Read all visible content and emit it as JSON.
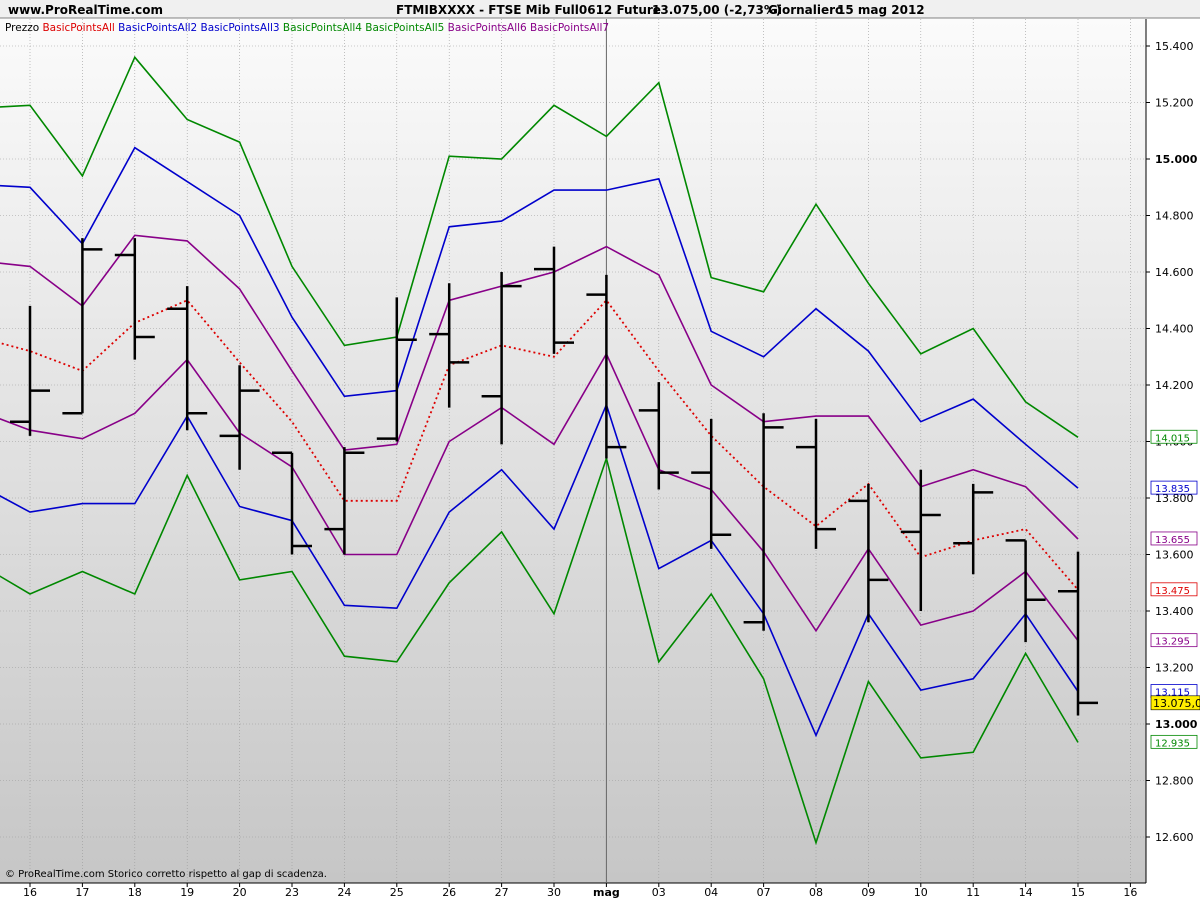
{
  "header": {
    "site": "www.ProRealTime.com",
    "instrument": "FTMIBXXXX - FTSE Mib Full0612 Future",
    "price_change": "13.075,00 (-2,73%)",
    "period": "Giornaliero",
    "date": "15 mag 2012",
    "bg_color": "#f0f0f0",
    "text_color": "#000000"
  },
  "footer_note": "© ProRealTime.com  Storico corretto rispetto al gap di scadenza.",
  "legend": [
    {
      "label": "Prezzo",
      "color": "#000000"
    },
    {
      "label": "BasicPointsAll",
      "color": "#dd0000"
    },
    {
      "label": "BasicPointsAll2",
      "color": "#0000cc"
    },
    {
      "label": "BasicPointsAll3",
      "color": "#0000cc"
    },
    {
      "label": "BasicPointsAll4",
      "color": "#008800"
    },
    {
      "label": "BasicPointsAll5",
      "color": "#008800"
    },
    {
      "label": "BasicPointsAll6",
      "color": "#880088"
    },
    {
      "label": "BasicPointsAll7",
      "color": "#880088"
    }
  ],
  "chart_data": {
    "type": "line",
    "ylim": [
      12480,
      15520
    ],
    "y_ticks": [
      "12.600",
      "12.800",
      "13.000",
      "13.200",
      "13.400",
      "13.600",
      "13.800",
      "14.000",
      "14.200",
      "14.400",
      "14.600",
      "14.800",
      "15.000",
      "15.200",
      "15.400"
    ],
    "y_tick_values": [
      12600,
      12800,
      13000,
      13200,
      13400,
      13600,
      13800,
      14000,
      14200,
      14400,
      14600,
      14800,
      15000,
      15200,
      15400
    ],
    "y_tick_bold": [
      "13.000",
      "15.000"
    ],
    "categories": [
      "16",
      "17",
      "18",
      "19",
      "20",
      "23",
      "24",
      "25",
      "26",
      "27",
      "30",
      "mag",
      "03",
      "04",
      "07",
      "08",
      "09",
      "10",
      "11",
      "14",
      "15",
      "16"
    ],
    "category_bold": [
      "mag"
    ],
    "category_separator": "mag",
    "ohlc": [
      {
        "o": 14070,
        "h": 14480,
        "l": 14020,
        "c": 14180
      },
      {
        "o": 14100,
        "h": 14720,
        "l": 14100,
        "c": 14680
      },
      {
        "o": 14660,
        "h": 14720,
        "l": 14290,
        "c": 14370
      },
      {
        "o": 14470,
        "h": 14550,
        "l": 14040,
        "c": 14100
      },
      {
        "o": 14020,
        "h": 14270,
        "l": 13900,
        "c": 14180
      },
      {
        "o": 13960,
        "h": 13960,
        "l": 13600,
        "c": 13630
      },
      {
        "o": 13690,
        "h": 13980,
        "l": 13600,
        "c": 13960
      },
      {
        "o": 14010,
        "h": 14510,
        "l": 14000,
        "c": 14360
      },
      {
        "o": 14380,
        "h": 14560,
        "l": 14120,
        "c": 14280
      },
      {
        "o": 14160,
        "h": 14600,
        "l": 13990,
        "c": 14550
      },
      {
        "o": 14610,
        "h": 14690,
        "l": 14310,
        "c": 14350
      },
      {
        "o": 14520,
        "h": 14590,
        "l": 13940,
        "c": 13980
      },
      {
        "o": 14110,
        "h": 14210,
        "l": 13830,
        "c": 13890
      },
      {
        "o": 13890,
        "h": 14080,
        "l": 13620,
        "c": 13670
      },
      {
        "o": 13360,
        "h": 14100,
        "l": 13330,
        "c": 14050
      },
      {
        "o": 13980,
        "h": 14080,
        "l": 13620,
        "c": 13690
      },
      {
        "o": 13790,
        "h": 13850,
        "l": 13360,
        "c": 13510
      },
      {
        "o": 13680,
        "h": 13900,
        "l": 13400,
        "c": 13740
      },
      {
        "o": 13640,
        "h": 13850,
        "l": 13530,
        "c": 13820
      },
      {
        "o": 13650,
        "h": 13650,
        "l": 13290,
        "c": 13440
      },
      {
        "o": 13470,
        "h": 13610,
        "l": 13030,
        "c": 13075
      }
    ],
    "series": [
      {
        "name": "BasicPointsAll",
        "color": "#dd0000",
        "dashed": true,
        "label": "13.475",
        "label_bg": "#ffffff",
        "values": [
          14370,
          14320,
          14250,
          14420,
          14500,
          14280,
          14070,
          13790,
          13790,
          14270,
          14340,
          14300,
          14500,
          14250,
          14020,
          13840,
          13700,
          13850,
          13590,
          13650,
          13690,
          13475
        ]
      },
      {
        "name": "BasicPointsAll2",
        "color": "#0000cc",
        "dashed": false,
        "label": "13.835",
        "label_bg": "#ffffff",
        "values": [
          14910,
          14900,
          14700,
          15040,
          14920,
          14800,
          14440,
          14160,
          14180,
          14760,
          14780,
          14890,
          14890,
          14930,
          14390,
          14300,
          14470,
          14320,
          14070,
          14150,
          13990,
          13835
        ]
      },
      {
        "name": "BasicPointsAll3",
        "color": "#0000cc",
        "dashed": false,
        "label": "13.115",
        "label_bg": "#ffffff",
        "values": [
          13850,
          13750,
          13780,
          13780,
          14090,
          13770,
          13720,
          13420,
          13410,
          13750,
          13900,
          13690,
          14130,
          13550,
          13650,
          13390,
          12960,
          13390,
          13120,
          13160,
          13390,
          13115
        ]
      },
      {
        "name": "BasicPointsAll4",
        "color": "#008800",
        "dashed": false,
        "label": "14.015",
        "label_bg": "#ffffff",
        "values": [
          15180,
          15190,
          14940,
          15360,
          15140,
          15060,
          14620,
          14340,
          14370,
          15010,
          15000,
          15190,
          15080,
          15270,
          14580,
          14530,
          14840,
          14560,
          14310,
          14400,
          14140,
          14015
        ]
      },
      {
        "name": "BasicPointsAll5",
        "color": "#008800",
        "dashed": false,
        "label": "12.935",
        "label_bg": "#ffffff",
        "values": [
          13570,
          13460,
          13540,
          13460,
          13880,
          13510,
          13540,
          13240,
          13220,
          13500,
          13680,
          13390,
          13940,
          13220,
          13460,
          13160,
          12580,
          13150,
          12880,
          12900,
          13250,
          12935
        ]
      },
      {
        "name": "BasicPointsAll6",
        "color": "#880088",
        "dashed": false,
        "label": "13.655",
        "label_bg": "#ffffff",
        "values": [
          14640,
          14620,
          14480,
          14730,
          14710,
          14540,
          14250,
          13970,
          13990,
          14500,
          14550,
          14600,
          14690,
          14590,
          14200,
          14070,
          14090,
          14090,
          13840,
          13900,
          13840,
          13655
        ]
      },
      {
        "name": "BasicPointsAll7",
        "color": "#880088",
        "dashed": false,
        "label": "13.295",
        "label_bg": "#ffffff",
        "values": [
          14110,
          14040,
          14010,
          14100,
          14290,
          14030,
          13910,
          13600,
          13600,
          14000,
          14120,
          13990,
          14310,
          13900,
          13830,
          13610,
          13330,
          13620,
          13350,
          13400,
          13540,
          13295
        ]
      }
    ],
    "price_label": {
      "text": "13.075,0",
      "value": 13075,
      "bg": "#ffee00"
    },
    "background": {
      "top": "#fbfbfb",
      "bottom": "#c6c6c6"
    },
    "grid": true,
    "ohlc_color": "#000000"
  }
}
